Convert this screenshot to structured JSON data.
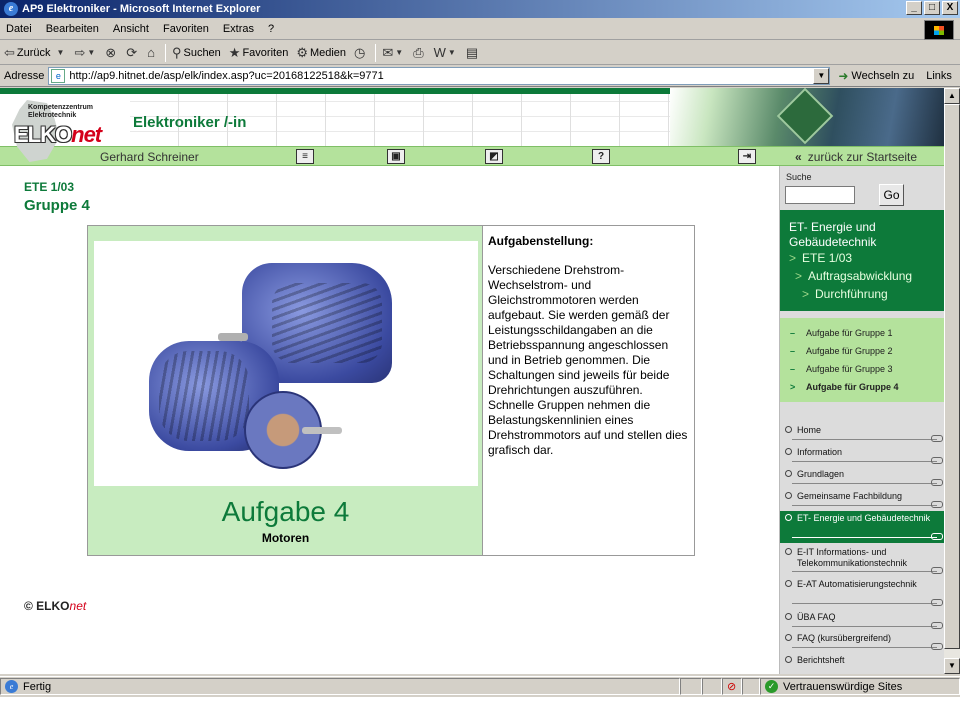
{
  "window": {
    "title": "AP9 Elektroniker - Microsoft Internet Explorer",
    "buttons": [
      "_",
      "□",
      "X"
    ]
  },
  "menu": [
    "Datei",
    "Bearbeiten",
    "Ansicht",
    "Favoriten",
    "Extras",
    "?"
  ],
  "toolbar": {
    "back": "Zurück",
    "search": "Suchen",
    "favorites": "Favoriten",
    "media": "Medien"
  },
  "address": {
    "label": "Adresse",
    "url": "http://ap9.hitnet.de/asp/elk/index.asp?uc=20168122518&k=9771",
    "goto": "Wechseln zu",
    "links": "Links"
  },
  "header": {
    "logo_small": "Kompetenzzentrum Elektrotechnik",
    "logo_main": "ELKO",
    "logo_net": "net",
    "headline": "Elektroniker /-in",
    "user": "Gerhard Schreiner",
    "back_home": "zurück zur Startseite"
  },
  "main": {
    "code": "ETE 1/03",
    "group": "Gruppe 4",
    "task_title": "Aufgabe 4",
    "task_subtitle": "Motoren",
    "desc_heading": "Aufgabenstellung:",
    "desc_text": "Verschiedene Drehstrom- Wechselstrom- und Gleichstrommotoren werden aufgebaut. Sie werden gemäß der Leistungsschildangaben an die Betriebsspannung angeschlossen und in Betrieb genommen. Die Schaltungen sind jeweils für beide Drehrichtungen auszuführen. Schnelle Gruppen nehmen die Belastungskennlinien eines Drehstrommotors auf und stellen dies grafisch dar.",
    "copyright_prefix": "© ELKO",
    "copyright_net": "net"
  },
  "sidebar": {
    "search_label": "Suche",
    "search_value": "",
    "go": "Go",
    "section_title": "ET- Energie und Gebäudetechnik",
    "section_subs": [
      "ETE 1/03",
      "Auftragsabwicklung",
      "Durchführung"
    ],
    "groups": [
      "Aufgabe für Gruppe 1",
      "Aufgabe für Gruppe 2",
      "Aufgabe für Gruppe 3",
      "Aufgabe für Gruppe 4"
    ],
    "nav": [
      "Home",
      "Information",
      "Grundlagen",
      "Gemeinsame Fachbildung",
      "ET- Energie und Gebäudetechnik",
      "E-IT Informations- und Telekommunikationstechnik",
      "E-AT Automatisierungstechnik",
      "ÜBA FAQ",
      "FAQ (kursübergreifend)",
      "Berichtsheft"
    ]
  },
  "status": {
    "text": "Fertig",
    "zone": "Vertrauenswürdige Sites"
  }
}
